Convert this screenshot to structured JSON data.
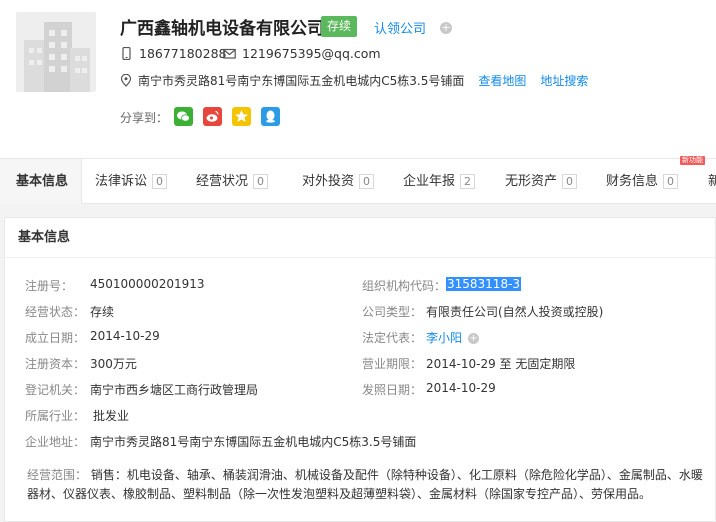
{
  "company": {
    "name": "广西鑫轴机电设备有限公司",
    "status": "存续",
    "claim_label": "认领公司",
    "phone": "18677180288",
    "email": "1219675395@qq.com",
    "address": "南宁市秀灵路81号南宁东博国际五金机电城内C5栋3.5号铺面",
    "view_map": "查看地图",
    "address_search": "地址搜索",
    "share_label": "分享到："
  },
  "tabs": [
    {
      "label": "基本信息",
      "count": ""
    },
    {
      "label": "法律诉讼",
      "count": "0"
    },
    {
      "label": "经营状况",
      "count": "0"
    },
    {
      "label": "对外投资",
      "count": "0"
    },
    {
      "label": "企业年报",
      "count": "2"
    },
    {
      "label": "无形资产",
      "count": "0"
    },
    {
      "label": "财务信息",
      "count": "0"
    },
    {
      "label": "新",
      "count": ""
    }
  ],
  "new_badge": "新功能",
  "panel": {
    "title": "基本信息",
    "left": [
      {
        "label": "注册号：",
        "value": "450100000201913"
      },
      {
        "label": "经营状态：",
        "value": "存续"
      },
      {
        "label": "成立日期：",
        "value": "2014-10-29"
      },
      {
        "label": "注册资本：",
        "value": "300万元"
      },
      {
        "label": "登记机关：",
        "value": "南宁市西乡塘区工商行政管理局"
      },
      {
        "label": "所属行业：",
        "value": "批发业"
      },
      {
        "label": "企业地址：",
        "value": "南宁市秀灵路81号南宁东博国际五金机电城内C5栋3.5号铺面"
      }
    ],
    "right": [
      {
        "label": "组织机构代码：",
        "value": "31583118-3"
      },
      {
        "label": "公司类型：",
        "value": "有限责任公司(自然人投资或控股)"
      },
      {
        "label": "法定代表：",
        "value": "李小阳"
      },
      {
        "label": "营业期限：",
        "value": "2014-10-29 至 无固定期限"
      },
      {
        "label": "发照日期：",
        "value": "2014-10-29"
      }
    ],
    "scope_label": "经营范围：",
    "scope_text": "销售：机电设备、轴承、桶装润滑油、机械设备及配件（除特种设备）、化工原料（除危险化学品）、金属制品、水暖器材、仪器仪表、橡胶制品、塑料制品（除一次性发泡塑料及超薄塑料袋）、金属材料（除国家专控产品）、劳保用品。"
  },
  "colors": {
    "accent": "#128bed",
    "status_green": "#5cb85c",
    "highlight": "#3390ff"
  },
  "icons": [
    "building-logo-icon",
    "phone-icon",
    "mail-icon",
    "location-icon",
    "wechat-icon",
    "weibo-icon",
    "qzone-icon",
    "qq-icon",
    "plus-icon"
  ]
}
